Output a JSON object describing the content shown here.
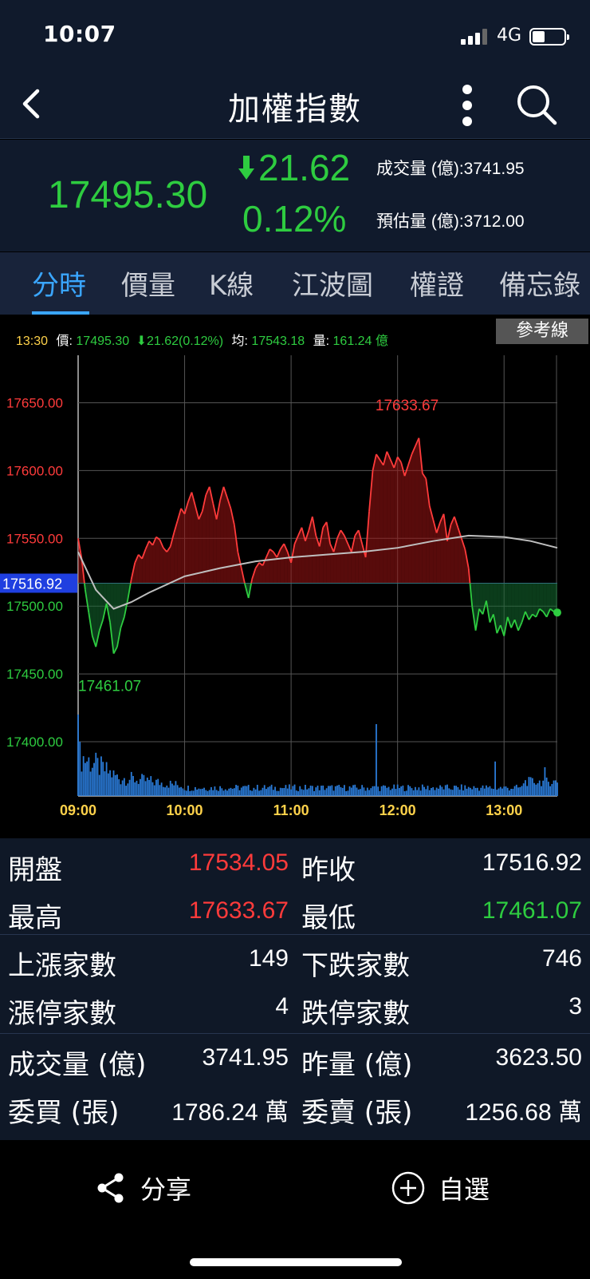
{
  "status": {
    "time": "10:07",
    "network": "4G",
    "battery_level": 0.4
  },
  "nav": {
    "title": "加權指數"
  },
  "quote": {
    "price": "17495.30",
    "change": "21.62",
    "change_pct": "0.12%",
    "volume_label": "成交量 (億):3741.95",
    "est_volume_label": "預估量 (億):3712.00",
    "colors": {
      "up": "#ff3b3b",
      "down": "#2ecc40",
      "accent": "#3aa6ff"
    }
  },
  "tabs": [
    {
      "label": "分時",
      "active": true
    },
    {
      "label": "價量",
      "active": false
    },
    {
      "label": "K線",
      "active": false
    },
    {
      "label": "江波圖",
      "active": false
    },
    {
      "label": "權證",
      "active": false
    },
    {
      "label": "備忘錄",
      "active": false
    }
  ],
  "info_row": {
    "time": "13:30",
    "price_label": "價:",
    "price": "17495.30",
    "change": "21.62(0.12%)",
    "avg_label": "均:",
    "avg": "17543.18",
    "vol_label": "量:",
    "vol": "161.24 億"
  },
  "ref_button": "參考線",
  "chart_data": {
    "type": "line",
    "reference": 17516.92,
    "reference_label": "17516.92",
    "ylim": [
      17360,
      17685
    ],
    "y_ticks": [
      {
        "value": 17650,
        "label": "17650.00"
      },
      {
        "value": 17600,
        "label": "17600.00"
      },
      {
        "value": 17550,
        "label": "17550.00"
      },
      {
        "value": 17500,
        "label": "17500.00"
      },
      {
        "value": 17450,
        "label": "17450.00"
      },
      {
        "value": 17400,
        "label": "17400.00"
      }
    ],
    "x_ticks": [
      {
        "minute": 0,
        "label": "09:00"
      },
      {
        "minute": 60,
        "label": "10:00"
      },
      {
        "minute": 120,
        "label": "11:00"
      },
      {
        "minute": 180,
        "label": "12:00"
      },
      {
        "minute": 240,
        "label": "13:00"
      }
    ],
    "high_label": "17633.67",
    "low_label": "17461.07",
    "high_point": {
      "minute": 190,
      "value": 17633.67
    },
    "low_point": {
      "minute": 20,
      "value": 17461.07
    },
    "price_series": {
      "minutes": [
        0,
        2,
        4,
        6,
        8,
        10,
        12,
        14,
        16,
        18,
        20,
        22,
        24,
        26,
        28,
        30,
        32,
        34,
        36,
        38,
        40,
        42,
        44,
        46,
        48,
        50,
        52,
        54,
        56,
        58,
        60,
        62,
        64,
        66,
        68,
        70,
        72,
        74,
        76,
        78,
        80,
        82,
        84,
        86,
        88,
        90,
        92,
        94,
        96,
        98,
        100,
        102,
        104,
        106,
        108,
        110,
        112,
        114,
        116,
        118,
        120,
        122,
        124,
        126,
        128,
        130,
        132,
        134,
        136,
        138,
        140,
        142,
        144,
        146,
        148,
        150,
        152,
        154,
        156,
        158,
        160,
        162,
        164,
        166,
        168,
        170,
        172,
        174,
        176,
        178,
        180,
        182,
        184,
        186,
        188,
        190,
        192,
        194,
        196,
        198,
        200,
        202,
        204,
        206,
        208,
        210,
        212,
        214,
        216,
        218,
        220,
        222,
        224,
        226,
        228,
        230,
        232,
        234,
        236,
        238,
        240,
        242,
        244,
        246,
        248,
        250,
        252,
        254,
        256,
        258,
        260,
        262,
        264,
        266,
        268,
        270
      ],
      "values": [
        17550,
        17535,
        17512,
        17495,
        17478,
        17470,
        17482,
        17490,
        17502,
        17488,
        17465,
        17470,
        17484,
        17492,
        17505,
        17520,
        17532,
        17538,
        17535,
        17542,
        17548,
        17545,
        17551,
        17549,
        17543,
        17540,
        17544,
        17554,
        17563,
        17572,
        17568,
        17577,
        17584,
        17574,
        17564,
        17570,
        17582,
        17588,
        17576,
        17564,
        17578,
        17588,
        17580,
        17572,
        17560,
        17540,
        17528,
        17516,
        17506,
        17520,
        17528,
        17532,
        17530,
        17536,
        17542,
        17540,
        17536,
        17542,
        17546,
        17540,
        17532,
        17546,
        17552,
        17558,
        17548,
        17556,
        17566,
        17552,
        17544,
        17558,
        17562,
        17546,
        17540,
        17550,
        17556,
        17552,
        17546,
        17540,
        17552,
        17556,
        17546,
        17536,
        17570,
        17600,
        17612,
        17608,
        17604,
        17614,
        17608,
        17602,
        17610,
        17606,
        17596,
        17604,
        17612,
        17618,
        17624,
        17598,
        17594,
        17574,
        17564,
        17554,
        17562,
        17568,
        17548,
        17560,
        17566,
        17558,
        17550,
        17542,
        17528,
        17500,
        17482,
        17498,
        17494,
        17504,
        17488,
        17494,
        17480,
        17486,
        17478,
        17492,
        17484,
        17490,
        17482,
        17488,
        17496,
        17490,
        17494,
        17492,
        17498,
        17496,
        17492,
        17498,
        17496,
        17495.3
      ]
    },
    "avg_series": {
      "minutes": [
        0,
        10,
        20,
        30,
        40,
        50,
        60,
        80,
        100,
        120,
        140,
        160,
        180,
        200,
        220,
        240,
        255,
        270
      ],
      "values": [
        17540,
        17512,
        17498,
        17503,
        17510,
        17516,
        17522,
        17528,
        17533,
        17536,
        17538,
        17540,
        17543,
        17548,
        17552,
        17551,
        17548,
        17543
      ]
    },
    "volume_series": {
      "ymax": 170,
      "spikes": [
        {
          "minute": 0,
          "value": 170
        },
        {
          "minute": 168,
          "value": 150
        },
        {
          "minute": 235,
          "value": 72
        },
        {
          "minute": 263,
          "value": 60
        }
      ]
    }
  },
  "stats": [
    {
      "label_l": "開盤",
      "value_l": "17534.05",
      "color_l": "up",
      "label_r": "昨收",
      "value_r": "17516.92",
      "color_r": ""
    },
    {
      "label_l": "最高",
      "value_l": "17633.67",
      "color_l": "up",
      "label_r": "最低",
      "value_r": "17461.07",
      "color_r": "down"
    },
    {
      "label_l": "上漲家數",
      "value_l": "149",
      "color_l": "",
      "label_r": "下跌家數",
      "value_r": "746",
      "color_r": ""
    },
    {
      "label_l": "漲停家數",
      "value_l": "4",
      "color_l": "",
      "label_r": "跌停家數",
      "value_r": "3",
      "color_r": ""
    },
    {
      "label_l": "成交量 (億)",
      "value_l": "3741.95",
      "color_l": "",
      "label_r": "昨量 (億)",
      "value_r": "3623.50",
      "color_r": ""
    },
    {
      "label_l": "委買 (張)",
      "value_l": "1786.24 萬",
      "color_l": "",
      "label_r": "委賣 (張)",
      "value_r": "1256.68 萬",
      "color_r": ""
    }
  ],
  "bottom": {
    "share": "分享",
    "watchlist": "自選"
  }
}
